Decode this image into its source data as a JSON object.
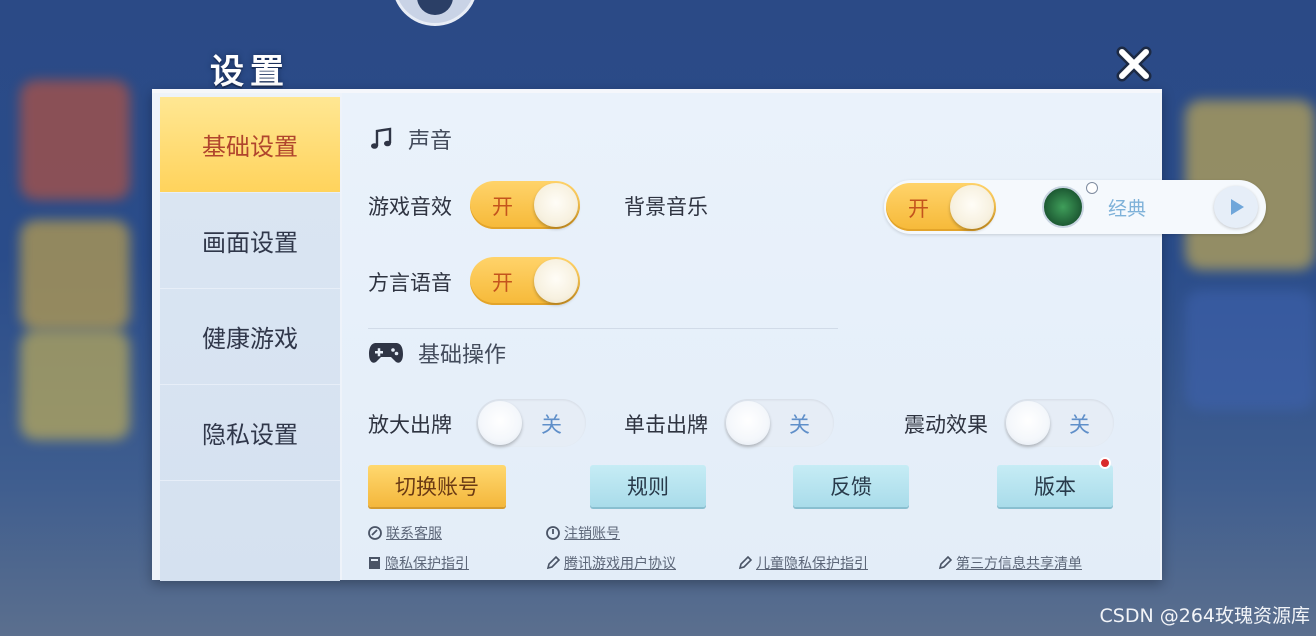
{
  "window": {
    "title": "设置"
  },
  "sidebar": {
    "items": [
      {
        "label": "基础设置",
        "active": true
      },
      {
        "label": "画面设置",
        "active": false
      },
      {
        "label": "健康游戏",
        "active": false
      },
      {
        "label": "隐私设置",
        "active": false
      }
    ]
  },
  "sound": {
    "section_title": "声音",
    "game_sfx": {
      "label": "游戏音效",
      "state": "开"
    },
    "bg_music": {
      "label": "背景音乐",
      "state": "开",
      "track": "经典"
    },
    "dialect_voice": {
      "label": "方言语音",
      "state": "开"
    }
  },
  "controls": {
    "section_title": "基础操作",
    "zoom_play": {
      "label": "放大出牌",
      "state": "关"
    },
    "single_tap_play": {
      "label": "单击出牌",
      "state": "关"
    },
    "vibration": {
      "label": "震动效果",
      "state": "关"
    }
  },
  "buttons": {
    "switch_account": "切换账号",
    "rules": "规则",
    "feedback": "反馈",
    "version": "版本"
  },
  "links": {
    "contact_support": "联系客服",
    "cancel_account": "注销账号",
    "privacy_policy": "隐私保护指引",
    "user_agreement": "腾讯游戏用户协议",
    "children_privacy": "儿童隐私保护指引",
    "third_party_sharing": "第三方信息共享清单"
  },
  "watermark": "CSDN @264玫瑰资源库",
  "colors": {
    "accent_yellow": "#f6b938",
    "active_tab_text": "#b0452d",
    "off_text": "#5f8fc9",
    "notification_dot": "#d92b2b"
  },
  "icons": [
    "music-note-icon",
    "gamepad-icon",
    "close-icon",
    "play-icon",
    "headset-icon",
    "power-icon",
    "doc-icon",
    "pen-icon"
  ]
}
